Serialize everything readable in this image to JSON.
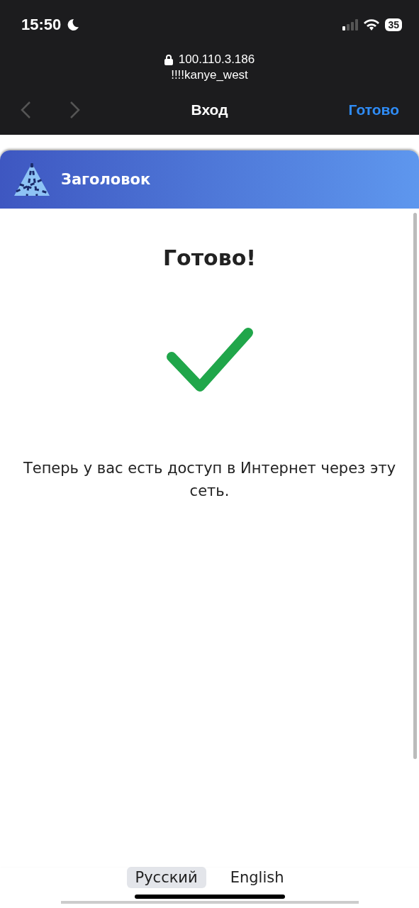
{
  "status_bar": {
    "time": "15:50",
    "battery": "35"
  },
  "browser": {
    "address": "100.110.3.186",
    "network": "!!!!kanye_west",
    "title": "Вход",
    "done": "Готово"
  },
  "page": {
    "header_title": "Заголовок",
    "heading": "Готово!",
    "message": "Теперь у вас есть доступ в Интернет через эту сеть."
  },
  "languages": [
    {
      "label": "Русский",
      "selected": true
    },
    {
      "label": "English",
      "selected": false
    }
  ]
}
